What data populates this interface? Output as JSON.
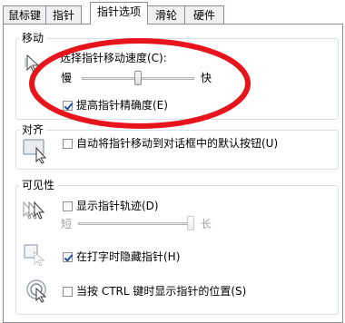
{
  "tabs": [
    {
      "label": "鼠标键"
    },
    {
      "label": "指针"
    },
    {
      "label": "指针选项"
    },
    {
      "label": "滑轮"
    },
    {
      "label": "硬件"
    }
  ],
  "motion": {
    "legend": "移动",
    "speed_label": "选择指针移动速度(C):",
    "slow_label": "慢",
    "fast_label": "快",
    "speed_value": 0.5,
    "precision_label": "提高指针精确度(E)",
    "precision_checked": true
  },
  "snap": {
    "legend": "对齐",
    "label": "自动将指针移动到对话框中的默认按钮(U)",
    "checked": false
  },
  "visibility": {
    "legend": "可见性",
    "trails_label": "显示指针轨迹(D)",
    "trails_checked": false,
    "short_label": "短",
    "long_label": "长",
    "trails_value": 1.0,
    "hide_label": "在打字时隐藏指针(H)",
    "hide_checked": true,
    "ctrl_label": "当按 CTRL 键时显示指针的位置(S)",
    "ctrl_checked": false
  },
  "annotation": {
    "color": "#e8141b"
  }
}
